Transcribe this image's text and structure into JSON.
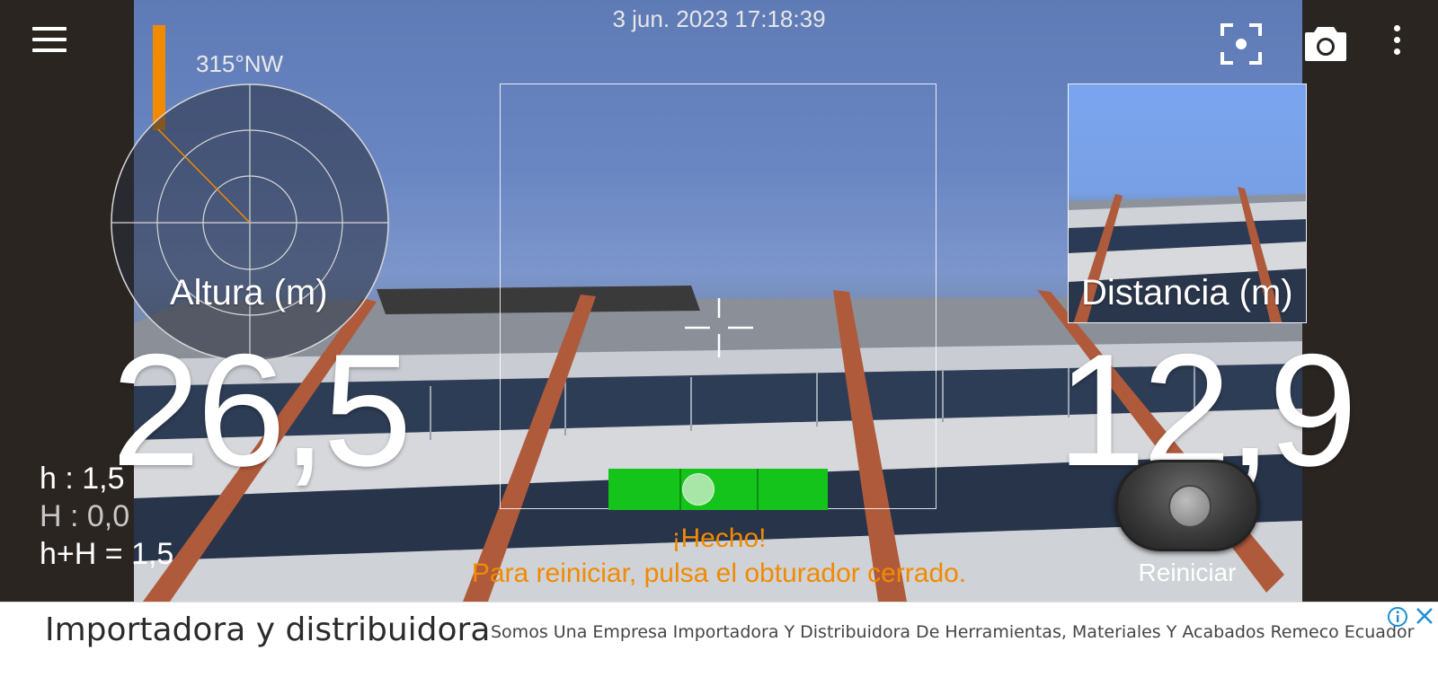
{
  "header": {
    "datetime": "3 jun. 2023 17:18:39",
    "menu_icon": "hamburger-menu-icon",
    "focus_icon": "focus-target-icon",
    "camera_icon": "camera-icon",
    "more_icon": "more-vert-icon"
  },
  "compass": {
    "heading": "315°NW"
  },
  "height": {
    "label": "Altura (m)",
    "value": "26,5"
  },
  "distance": {
    "label": "Distancia (m)",
    "value": "12,9"
  },
  "stats": {
    "h": "h : 1,5",
    "H": "H : 0,0",
    "sum": "h+H = 1,5"
  },
  "status": {
    "line1": "¡Hecho!",
    "line2": "Para reiniciar, pulsa el obturador cerrado."
  },
  "shutter": {
    "label": "Reiniciar"
  },
  "ad": {
    "title": "Importadora y distribuidora",
    "description": "Somos Una Empresa Importadora Y Distribuidora De Herramientas, Materiales Y Acabados Remeco Ecuador",
    "info_icon": "info-icon",
    "close_icon": "close-icon"
  },
  "colors": {
    "accent": "#f28a00",
    "level_green": "#14c41a",
    "bar_dark": "#2b2522"
  }
}
